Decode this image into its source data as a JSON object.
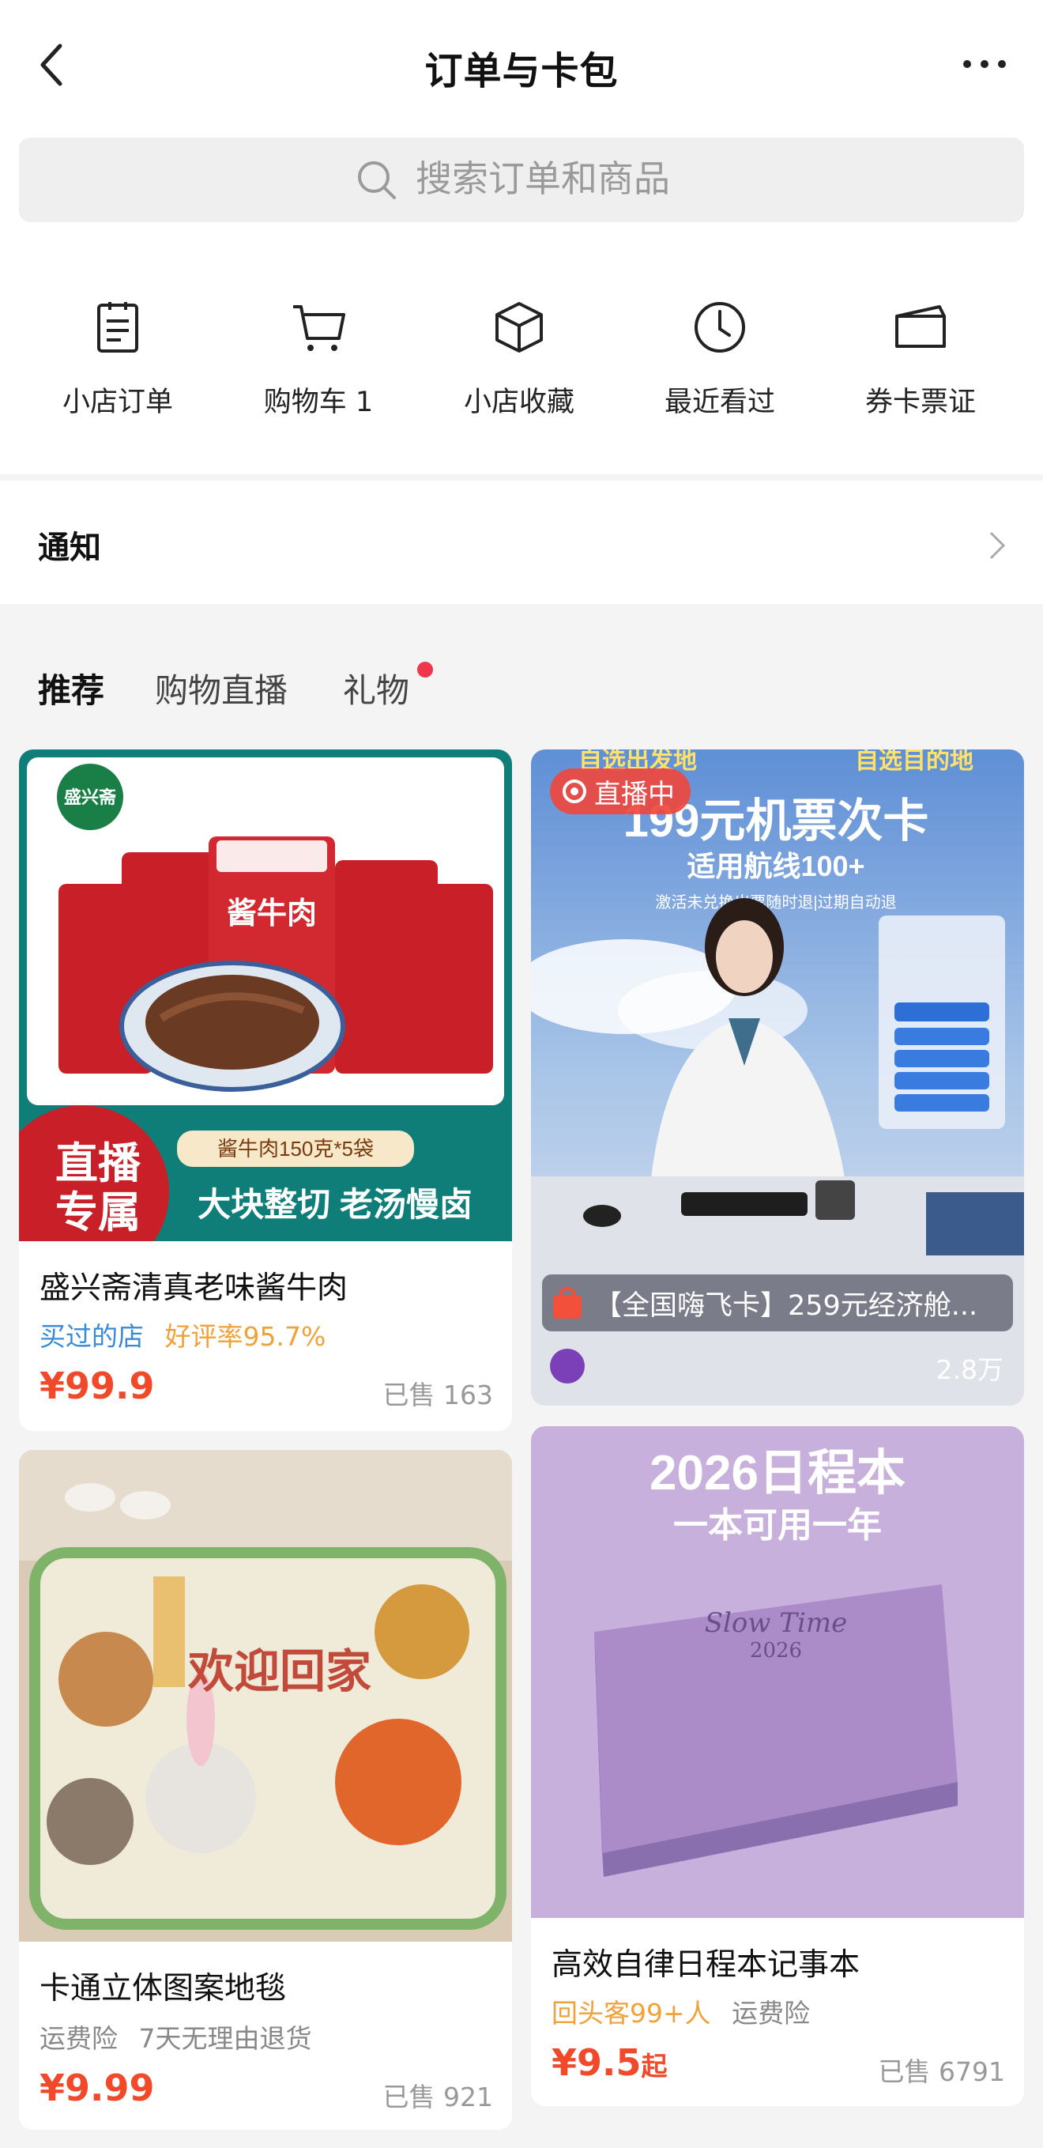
{
  "header": {
    "title": "订单与卡包"
  },
  "search": {
    "placeholder": "搜索订单和商品"
  },
  "quick_nav": [
    {
      "label": "小店订单",
      "icon": "clipboard-icon"
    },
    {
      "label": "购物车 1",
      "icon": "cart-icon"
    },
    {
      "label": "小店收藏",
      "icon": "box-icon"
    },
    {
      "label": "最近看过",
      "icon": "clock-icon"
    },
    {
      "label": "券卡票证",
      "icon": "wallet-icon"
    }
  ],
  "notice": {
    "label": "通知"
  },
  "tabs": [
    {
      "label": "推荐",
      "active": true
    },
    {
      "label": "购物直播",
      "active": false
    },
    {
      "label": "礼物",
      "active": false,
      "dot": true
    }
  ],
  "products": [
    {
      "title": "盛兴斋清真老味酱牛肉",
      "tags": [
        {
          "text": "买过的店",
          "color": "blue"
        },
        {
          "text": "好评率95.7%",
          "color": "orange"
        }
      ],
      "price": "¥99.9",
      "sold": "已售 163",
      "image": {
        "brand": "盛兴斋",
        "product": "酱牛肉",
        "spec": "酱牛肉150克*5袋",
        "badge_line1": "直播",
        "badge_line2": "专属",
        "slogan": "大块整切 老汤慢卤"
      }
    },
    {
      "live_badge": "直播中",
      "live_title": "【全国嗨飞卡】259元经济舱...",
      "viewers": "2.8万",
      "image": {
        "top_left": "自选出发地",
        "top_right": "自选目的地",
        "headline": "199元机票次卡",
        "subline": "适用航线100+",
        "note": "激活未兑换出票随时退|过期自动退"
      }
    },
    {
      "title": "卡通立体图案地毯",
      "tags": [
        {
          "text": "运费险",
          "color": "gray"
        },
        {
          "text": "7天无理由退货",
          "color": "gray"
        }
      ],
      "price": "¥9.99",
      "sold": "已售 921",
      "image": {
        "text": "欢迎回家"
      }
    },
    {
      "title": "高效自律日程本记事本",
      "tags": [
        {
          "text": "回头客99+人",
          "color": "orange"
        },
        {
          "text": "运费险",
          "color": "gray"
        }
      ],
      "price": "¥9.5",
      "price_suffix": "起",
      "sold": "已售 6791",
      "image": {
        "headline": "2026日程本",
        "subline": "一本可用一年",
        "cover_text": "Slow Time",
        "cover_year": "2026"
      }
    }
  ]
}
